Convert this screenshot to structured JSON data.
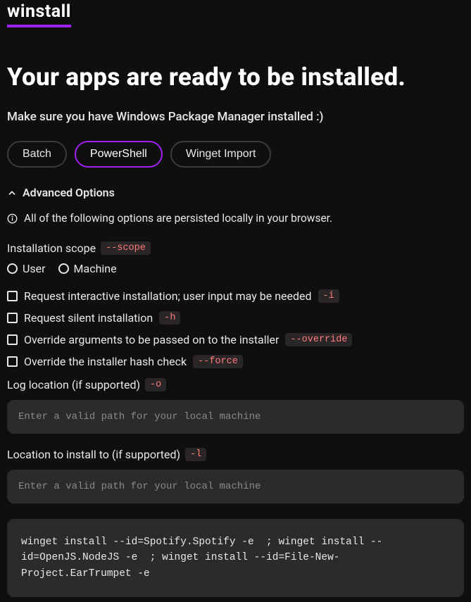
{
  "logo": "winstall",
  "heading": "Your apps are ready to be installed.",
  "subtitle": "Make sure you have Windows Package Manager installed :)",
  "tabs": {
    "batch": "Batch",
    "powershell": "PowerShell",
    "winget_import": "Winget Import"
  },
  "adv_toggle": "Advanced Options",
  "info_note": "All of the following options are persisted locally in your browser.",
  "scope": {
    "label": "Installation scope",
    "flag": "--scope",
    "user": "User",
    "machine": "Machine"
  },
  "opts": {
    "interactive": {
      "label": "Request interactive installation; user input may be needed",
      "flag": "-i"
    },
    "silent": {
      "label": "Request silent installation",
      "flag": "-h"
    },
    "override": {
      "label": "Override arguments to be passed on to the installer",
      "flag": "--override"
    },
    "force": {
      "label": "Override the installer hash check",
      "flag": "--force"
    }
  },
  "log": {
    "label": "Log location (if supported)",
    "flag": "-o",
    "placeholder": "Enter a valid path for your local machine"
  },
  "install_loc": {
    "label": "Location to install to (if supported)",
    "flag": "-l",
    "placeholder": "Enter a valid path for your local machine"
  },
  "command": "winget install --id=Spotify.Spotify -e  ; winget install --id=OpenJS.NodeJS -e  ; winget install --id=File-New-Project.EarTrumpet -e  "
}
